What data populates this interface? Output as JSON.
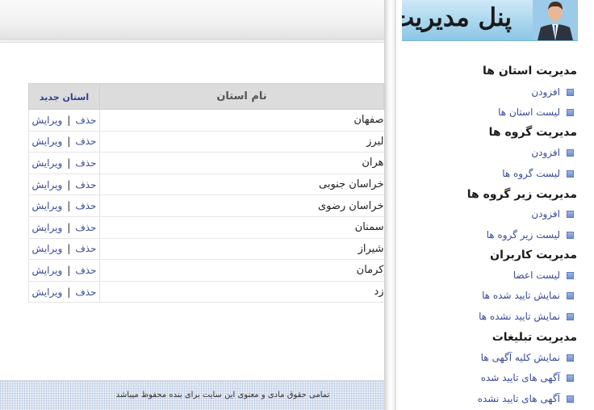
{
  "sidebar": {
    "banner_title": "پنل مدیریت",
    "sections": [
      {
        "title": "مدیریت استان ها",
        "items": [
          {
            "label": "افزودن"
          },
          {
            "label": "لیست استان ها"
          }
        ]
      },
      {
        "title": "مدیریت گروه ها",
        "items": [
          {
            "label": "افزودن"
          },
          {
            "label": "لیست گروه ها"
          }
        ]
      },
      {
        "title": "مدیریت زیر گروه ها",
        "items": [
          {
            "label": "افزودن"
          },
          {
            "label": "لیست زیر گروه ها"
          }
        ]
      },
      {
        "title": "مدیریت کاربران",
        "items": [
          {
            "label": "لیست اعضا"
          },
          {
            "label": "نمایش تایید شده ها"
          },
          {
            "label": "نمایش تایید نشده ها"
          }
        ]
      },
      {
        "title": "مدیریت تبلیغات",
        "items": [
          {
            "label": "نمایش کلیه آگهی ها"
          },
          {
            "label": "آگهی های تایید شده"
          },
          {
            "label": "آگهی های تایید نشده"
          }
        ]
      }
    ]
  },
  "table": {
    "header_name": "نام استان",
    "header_add": "استان جدید",
    "edit_label": "ویرایش",
    "delete_label": "حذف",
    "separator": "|",
    "rows": [
      "صفهان",
      "لبرز",
      "هران",
      "خراسان جنوبی",
      "خراسان رضوی",
      "سمنان",
      "شیراز",
      "کرمان",
      "زد"
    ]
  },
  "footer": {
    "text": "تمامی حقوق مادی و معنوی این سایت برای بنده محفوظ میباشد"
  },
  "colors": {
    "link": "#3a4a9a",
    "header_bg": "#dcdcdc",
    "banner_bg": "#a9d6ee"
  },
  "icons": {
    "banner_avatar": "businessman-avatar-icon",
    "menu_bullet": "square-bullet-icon"
  }
}
